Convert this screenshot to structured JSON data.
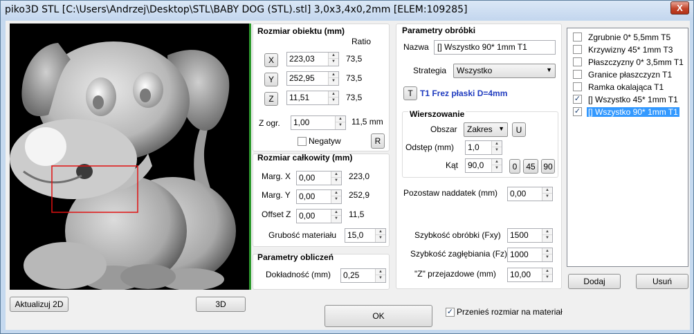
{
  "window": {
    "title": "piko3D STL [C:\\Users\\Andrzej\\Desktop\\STL\\BABY DOG (STL).stl] 3,0x3,4x0,2mm [ELEM:109285]",
    "close_label": "X"
  },
  "preview": {
    "refresh_label": "Aktualizuj 2D",
    "view3d_label": "3D"
  },
  "object_size": {
    "title": "Rozmiar obiektu (mm)",
    "ratio_label": "Ratio",
    "x": {
      "label": "X",
      "value": "223,03",
      "ratio": "73,5"
    },
    "y": {
      "label": "Y",
      "value": "252,95",
      "ratio": "73,5"
    },
    "z": {
      "label": "Z",
      "value": "11,51",
      "ratio": "73,5"
    },
    "zlimit": {
      "label": "Z ogr.",
      "value": "1,00",
      "text": "11,5 mm"
    },
    "negative_label": "Negatyw",
    "reset_label": "R"
  },
  "total_size": {
    "title": "Rozmiar całkowity (mm)",
    "marg_x": {
      "label": "Marg. X",
      "value": "0,00",
      "text": "223,0"
    },
    "marg_y": {
      "label": "Marg. Y",
      "value": "0,00",
      "text": "252,9"
    },
    "offset_z": {
      "label": "Offset Z",
      "value": "0,00",
      "text": "11,5"
    },
    "thickness": {
      "label": "Grubość materiału",
      "value": "15,0"
    }
  },
  "calc": {
    "title": "Parametry obliczeń",
    "accuracy": {
      "label": "Dokładność (mm)",
      "value": "0,25"
    }
  },
  "machining": {
    "title": "Parametry obróbki",
    "name_label": "Nazwa",
    "name_value": "[] Wszystko 90* 1mm T1",
    "strategy_label": "Strategia",
    "strategy_value": "Wszystko",
    "tool_button": "T",
    "tool_text": "T1 Frez płaski D=4mm"
  },
  "rows": {
    "title": "Wierszowanie",
    "area_label": "Obszar",
    "area_value": "Zakres",
    "u_button": "U",
    "step_label": "Odstęp (mm)",
    "step_value": "1,0",
    "angle_label": "Kąt",
    "angle_value": "90,0",
    "angle_buttons": [
      "0",
      "45",
      "90"
    ]
  },
  "params": {
    "allowance_label": "Pozostaw naddatek (mm)",
    "allowance_value": "0,00",
    "feed_label": "Szybkość obróbki (Fxy)",
    "feed_value": "1500",
    "plunge_label": "Szybkość zagłębiania (Fz)",
    "plunge_value": "1000",
    "zrapid_label": "\"Z\" przejazdowe (mm)",
    "zrapid_value": "10,00"
  },
  "operations": {
    "items": [
      {
        "label": "Zgrubnie 0* 5,5mm T5",
        "checked": false,
        "selected": false
      },
      {
        "label": "Krzywizny 45* 1mm T3",
        "checked": false,
        "selected": false
      },
      {
        "label": "Płaszczyzny 0* 3,5mm T1",
        "checked": false,
        "selected": false
      },
      {
        "label": "Granice płaszczyzn T1",
        "checked": false,
        "selected": false
      },
      {
        "label": "Ramka okalająca T1",
        "checked": false,
        "selected": false
      },
      {
        "label": "[] Wszystko 45* 1mm T1",
        "checked": true,
        "selected": false
      },
      {
        "label": "[] Wszystko 90* 1mm T1",
        "checked": true,
        "selected": true
      }
    ],
    "add_label": "Dodaj",
    "remove_label": "Usuń"
  },
  "footer": {
    "ok_label": "OK",
    "transfer_label": "Przenieś rozmiar na materiał",
    "transfer_checked": true
  },
  "icons": {
    "close": "close-icon",
    "spin": "spinner-arrows-icon",
    "caret": "chevron-down-icon",
    "check": "checkmark-icon"
  },
  "colors": {
    "selection": "#3399ff",
    "tool_text": "#1f3bbf",
    "preview_bg": "#000000",
    "selection_frame": "#e01010",
    "green_bar": "#2e9a2e"
  }
}
